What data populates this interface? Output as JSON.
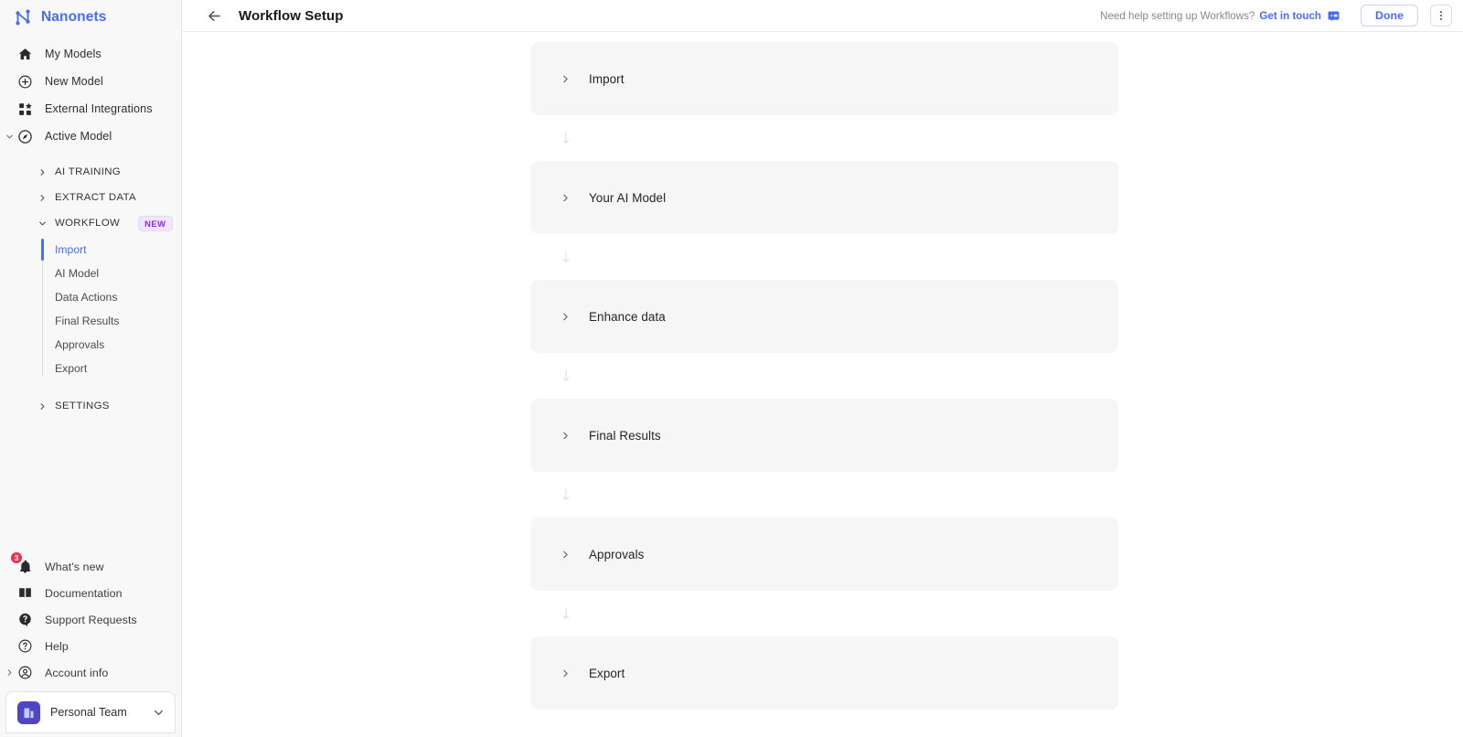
{
  "brand": {
    "name": "Nanonets",
    "logo_icon": "nanonets-network-logo"
  },
  "sidebar": {
    "top_items": [
      {
        "label": "My Models",
        "icon": "home-icon"
      },
      {
        "label": "New Model",
        "icon": "plus-circle-icon"
      },
      {
        "label": "External Integrations",
        "icon": "grid-apps-icon"
      },
      {
        "label": "Active Model",
        "icon": "compass-icon"
      }
    ],
    "sections": [
      {
        "label": "AI TRAINING",
        "expanded": false,
        "badge": null
      },
      {
        "label": "EXTRACT DATA",
        "expanded": false,
        "badge": null
      },
      {
        "label": "WORKFLOW",
        "expanded": true,
        "badge": "NEW"
      }
    ],
    "workflow_subitems": [
      {
        "label": "Import",
        "active": true
      },
      {
        "label": "AI Model",
        "active": false
      },
      {
        "label": "Data Actions",
        "active": false
      },
      {
        "label": "Final Results",
        "active": false
      },
      {
        "label": "Approvals",
        "active": false
      },
      {
        "label": "Export",
        "active": false
      }
    ],
    "settings_section": {
      "label": "SETTINGS",
      "expanded": false
    },
    "bottom_items": [
      {
        "label": "What's new",
        "icon": "bell-icon",
        "badge": "3"
      },
      {
        "label": "Documentation",
        "icon": "book-icon",
        "badge": null
      },
      {
        "label": "Support Requests",
        "icon": "support-chat-icon",
        "badge": null
      },
      {
        "label": "Help",
        "icon": "question-circle-icon",
        "badge": null
      },
      {
        "label": "Account info",
        "icon": "user-circle-icon",
        "badge": null
      }
    ],
    "team": {
      "name": "Personal Team",
      "icon": "building-icon",
      "chevron": "chevron-down-icon"
    }
  },
  "header": {
    "back_icon": "arrow-left-icon",
    "title": "Workflow Setup",
    "help_text": "Need help setting up Workflows?",
    "get_in_touch": "Get in touch",
    "chat_icon": "chat-bubble-icon",
    "done_label": "Done",
    "kebab_icon": "more-vertical-icon"
  },
  "workflow": {
    "steps": [
      {
        "label": "Import"
      },
      {
        "label": "Your AI Model"
      },
      {
        "label": "Enhance data"
      },
      {
        "label": "Final Results"
      },
      {
        "label": "Approvals"
      },
      {
        "label": "Export"
      }
    ],
    "connector_icon": "arrow-down-icon"
  },
  "colors": {
    "brand": "#4a6bf5",
    "badge_new_bg": "#f1e6fe",
    "badge_new_text": "#8b2bea",
    "notification_badge": "#e8334a",
    "card_bg": "#f6f6f7",
    "sidebar_bg": "#f8f8f9"
  }
}
